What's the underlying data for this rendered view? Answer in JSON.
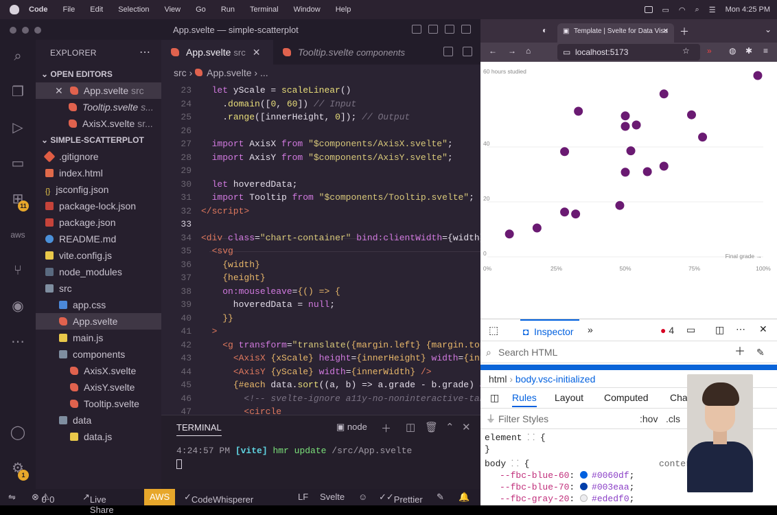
{
  "menubar": {
    "app": "Code",
    "items": [
      "File",
      "Edit",
      "Selection",
      "View",
      "Go",
      "Run",
      "Terminal",
      "Window",
      "Help"
    ],
    "clock": "Mon 4:25 PM"
  },
  "window": {
    "title": "App.svelte — simple-scatterplot"
  },
  "activity": {
    "source_control_badge": "11",
    "settings_badge": "1"
  },
  "sidebar": {
    "title": "EXPLORER",
    "open_editors_label": "OPEN EDITORS",
    "open_editors": [
      {
        "name": "App.svelte",
        "hint": "src"
      },
      {
        "name": "Tooltip.svelte",
        "hint": "s..."
      },
      {
        "name": "AxisX.svelte",
        "hint": "sr..."
      }
    ],
    "project_label": "SIMPLE-SCATTERPLOT",
    "files": [
      ".gitignore",
      "index.html",
      "jsconfig.json",
      "package-lock.json",
      "package.json",
      "README.md",
      "vite.config.js",
      "node_modules",
      "src",
      "app.css",
      "App.svelte",
      "main.js",
      "components",
      "AxisX.svelte",
      "AxisY.svelte",
      "Tooltip.svelte",
      "data",
      "data.js"
    ]
  },
  "tabs": [
    {
      "name": "App.svelte",
      "hint": "src"
    },
    {
      "name": "Tooltip.svelte",
      "hint": "components"
    }
  ],
  "breadcrumb": [
    "src",
    "App.svelte",
    "..."
  ],
  "editor": {
    "line_numbers": [
      "23",
      "24",
      "25",
      "26",
      "27",
      "28",
      "29",
      "30",
      "31",
      "32",
      "33",
      "34",
      "35",
      "36",
      "37",
      "38",
      "39",
      "40",
      "41",
      "42",
      "43",
      "44",
      "45",
      "46",
      "47"
    ],
    "current_line": "33"
  },
  "panel": {
    "title": "TERMINAL",
    "shell": "node",
    "time": "4:24:57 PM",
    "tag": "[vite]",
    "msg": "hmr update",
    "path": "/src/App.svelte"
  },
  "status": {
    "errors": "0",
    "warnings": "0",
    "live_share": "Live Share",
    "aws": "AWS",
    "codewhisperer": "CodeWhisperer",
    "eol": "LF",
    "lang": "Svelte",
    "prettier": "Prettier"
  },
  "browser": {
    "tab_title": "Template | Svelte for Data Visu",
    "url": "localhost:5173"
  },
  "chart_data": {
    "type": "scatter",
    "ylabel": "60 hours studied",
    "xlabel": "Final grade →",
    "xticks": [
      "0%",
      "25%",
      "50%",
      "75%",
      "100%"
    ],
    "yticks": [
      "40",
      "20",
      "0"
    ],
    "xlim": [
      0,
      100
    ],
    "ylim": [
      0,
      66
    ],
    "point_color": "#6a1a72",
    "points": [
      [
        8,
        8.3
      ],
      [
        18,
        10.5
      ],
      [
        28,
        16.3
      ],
      [
        32,
        15.6
      ],
      [
        28,
        38.3
      ],
      [
        33,
        53
      ],
      [
        50,
        51.3
      ],
      [
        50,
        47.5
      ],
      [
        54,
        48
      ],
      [
        52,
        38.6
      ],
      [
        50,
        30.8
      ],
      [
        48,
        18.7
      ],
      [
        58,
        31
      ],
      [
        64,
        33
      ],
      [
        64,
        59.3
      ],
      [
        74,
        51.7
      ],
      [
        78,
        43.6
      ],
      [
        98,
        66
      ]
    ]
  },
  "devtools": {
    "tab_inspector": "Inspector",
    "errors": "4",
    "search_placeholder": "Search HTML",
    "crumb_html": "html",
    "crumb_body": "body.vsc-initialized",
    "rules_tabs": [
      "Rules",
      "Layout",
      "Computed",
      "Cha"
    ],
    "filter_placeholder": "Filter Styles",
    "hov": ":hov",
    "cls": ".cls",
    "element_rule": "element",
    "body_rule": "body",
    "content_hint": "conter",
    "vars": [
      {
        "name": "--fbc-blue-60",
        "value": "#0060df"
      },
      {
        "name": "--fbc-blue-70",
        "value": "#003eaa"
      },
      {
        "name": "--fbc-gray-20",
        "value": "#ededf0"
      }
    ]
  }
}
